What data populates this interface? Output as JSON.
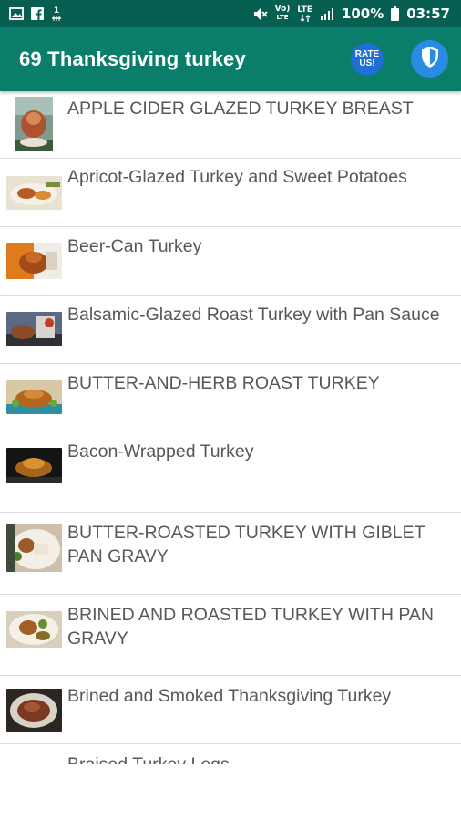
{
  "status_bar": {
    "badge_number": "1",
    "battery_percent": "100%",
    "time": "03:57",
    "lte_label": "LTE",
    "volte_label": "Vo)"
  },
  "app_bar": {
    "title": "69 Thanksgiving turkey",
    "rate_line1": "RATE",
    "rate_line2": "US!"
  },
  "recipes": [
    {
      "label": "APPLE CIDER GLAZED TURKEY BREAST"
    },
    {
      "label": "Apricot-Glazed Turkey and Sweet Potatoes"
    },
    {
      "label": "Beer-Can Turkey"
    },
    {
      "label": "Balsamic-Glazed Roast Turkey with Pan Sauce"
    },
    {
      "label": "BUTTER-AND-HERB ROAST TURKEY"
    },
    {
      "label": "Bacon-Wrapped Turkey"
    },
    {
      "label": "BUTTER-ROASTED TURKEY WITH GIBLET PAN GRAVY"
    },
    {
      "label": "BRINED AND ROASTED TURKEY WITH PAN GRAVY"
    },
    {
      "label": "Brined and Smoked Thanksgiving Turkey"
    },
    {
      "label": "Braised Turkey Legs"
    }
  ],
  "colors": {
    "status_bar": "#075f52",
    "app_bar": "#0b7d6b",
    "list_text": "#585858",
    "divider": "#dcdcdc"
  }
}
